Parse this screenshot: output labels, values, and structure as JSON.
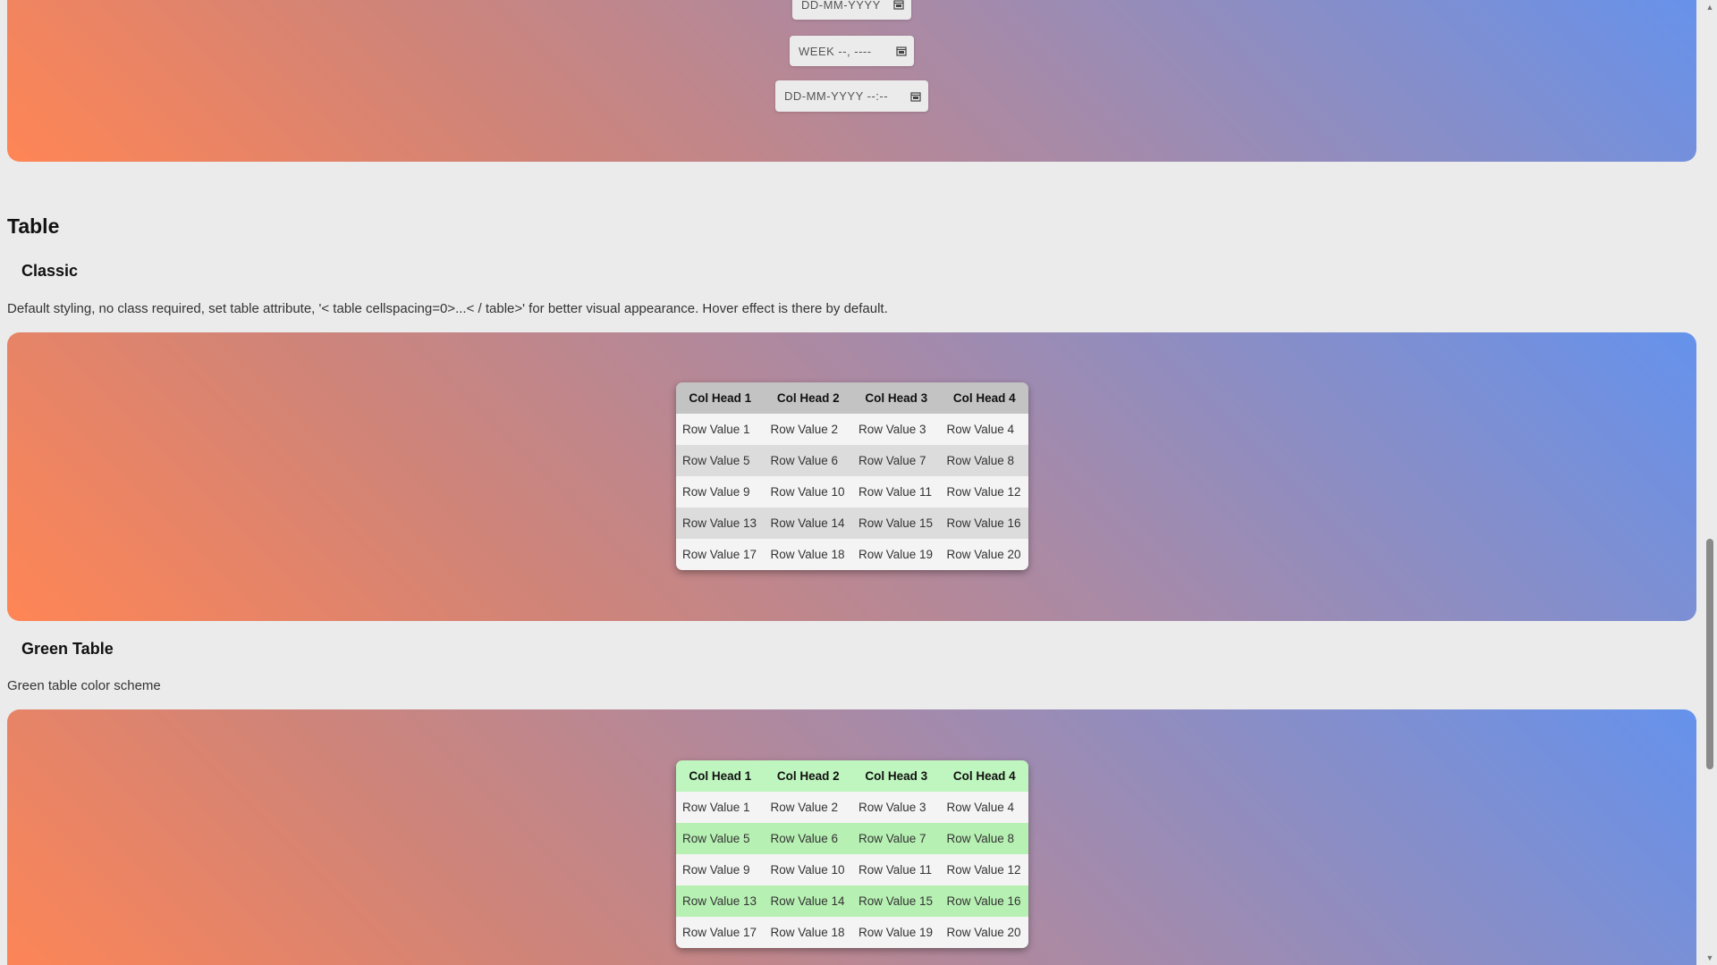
{
  "date_inputs": {
    "date_placeholder": "DD-MM-YYYY",
    "week_placeholder": "WEEK --, ----",
    "datetime_placeholder": "DD-MM-YYYY --:--"
  },
  "section_title": "Table",
  "classic": {
    "title": "Classic",
    "description": "Default styling, no class required, set table attribute, '< table cellspacing=0>...< / table>' for better visual appearance. Hover effect is there by default."
  },
  "green": {
    "title": "Green Table",
    "description": "Green table color scheme"
  },
  "table": {
    "headers": [
      "Col Head 1",
      "Col Head 2",
      "Col Head 3",
      "Col Head 4"
    ],
    "rows": [
      [
        "Row Value 1",
        "Row Value 2",
        "Row Value 3",
        "Row Value 4"
      ],
      [
        "Row Value 5",
        "Row Value 6",
        "Row Value 7",
        "Row Value 8"
      ],
      [
        "Row Value 9",
        "Row Value 10",
        "Row Value 11",
        "Row Value 12"
      ],
      [
        "Row Value 13",
        "Row Value 14",
        "Row Value 15",
        "Row Value 16"
      ],
      [
        "Row Value 17",
        "Row Value 18",
        "Row Value 19",
        "Row Value 20"
      ]
    ]
  },
  "icons": {
    "calendar": "calendar-icon",
    "scroll_up": "▲",
    "scroll_down": "▼"
  }
}
